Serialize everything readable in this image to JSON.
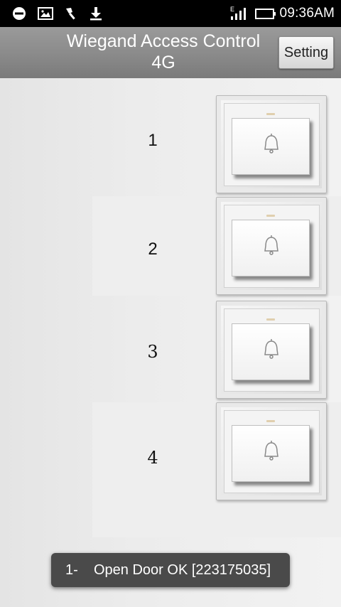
{
  "status_bar": {
    "time": "09:36AM",
    "icons": [
      "circle-minus-icon",
      "image-icon",
      "wrench-icon",
      "download-icon",
      "signal-icon",
      "battery-icon"
    ],
    "network": "E"
  },
  "title_bar": {
    "title_line1": "Wiegand Access Control",
    "title_line2": "4G",
    "setting_label": "Setting"
  },
  "doors": [
    {
      "label": "1"
    },
    {
      "label": "2"
    },
    {
      "label": "3"
    },
    {
      "label": "4"
    }
  ],
  "toast": {
    "prefix": "1-",
    "message": "Open Door OK [223175035]"
  }
}
